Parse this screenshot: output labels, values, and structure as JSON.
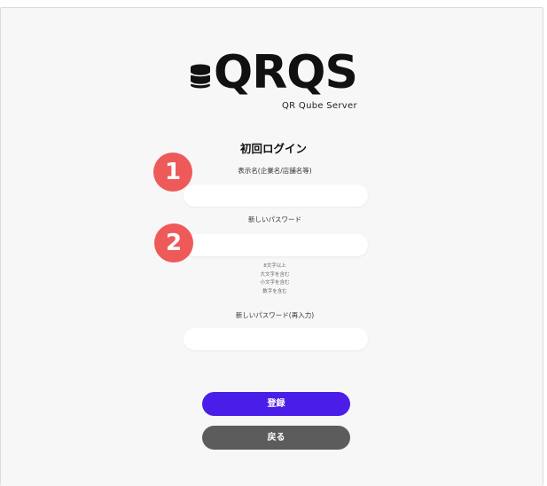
{
  "logo": {
    "text": "QRQS",
    "subtitle": "QR Qube Server",
    "icon": "database-icon"
  },
  "page_title": "初回ログイン",
  "fields": {
    "display_name": {
      "label": "表示名(企業名/店舗名等)",
      "value": "",
      "placeholder": ""
    },
    "new_password": {
      "label": "新しいパスワード",
      "value": "",
      "placeholder": ""
    },
    "new_password_confirm": {
      "label": "新しいパスワード(再入力)",
      "value": "",
      "placeholder": ""
    }
  },
  "password_rules": [
    "8文字以上",
    "大文字を含む",
    "小文字を含む",
    "数字を含む"
  ],
  "badges": {
    "first": "1",
    "second": "2"
  },
  "buttons": {
    "register": "登録",
    "back": "戻る"
  },
  "colors": {
    "primary": "#4b1de9",
    "back": "#5c5c5c",
    "badge": "#ee5a5a",
    "background": "#f7f7f7"
  }
}
